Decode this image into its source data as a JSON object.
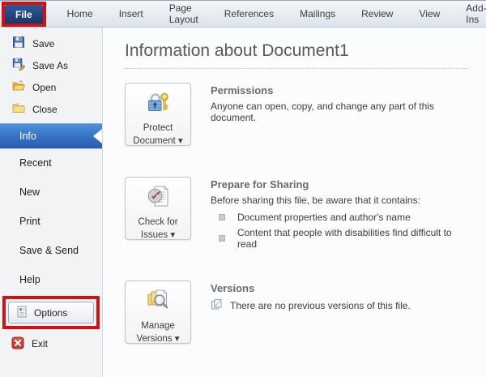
{
  "ribbon": {
    "tabs": [
      {
        "label": "File",
        "active": true
      },
      {
        "label": "Home"
      },
      {
        "label": "Insert"
      },
      {
        "label": "Page Layout"
      },
      {
        "label": "References"
      },
      {
        "label": "Mailings"
      },
      {
        "label": "Review"
      },
      {
        "label": "View"
      },
      {
        "label": "Add-Ins"
      }
    ]
  },
  "sidebar": {
    "file_commands": [
      {
        "label": "Save",
        "icon": "save-icon"
      },
      {
        "label": "Save As",
        "icon": "save-as-icon"
      },
      {
        "label": "Open",
        "icon": "open-folder-icon"
      },
      {
        "label": "Close",
        "icon": "close-folder-icon"
      }
    ],
    "nav_items": [
      {
        "label": "Info",
        "selected": true
      },
      {
        "label": "Recent"
      },
      {
        "label": "New"
      },
      {
        "label": "Print"
      },
      {
        "label": "Save & Send"
      },
      {
        "label": "Help"
      }
    ],
    "options_label": "Options",
    "exit_label": "Exit"
  },
  "content": {
    "title": "Information about Document1",
    "sections": [
      {
        "button_line1": "Protect",
        "button_line2": "Document ▾",
        "heading": "Permissions",
        "description": "Anyone can open, copy, and change any part of this document."
      },
      {
        "button_line1": "Check for",
        "button_line2": "Issues ▾",
        "heading": "Prepare for Sharing",
        "description": "Before sharing this file, be aware that it contains:",
        "bullets": [
          "Document properties and author's name",
          "Content that people with disabilities find difficult to read"
        ]
      },
      {
        "button_line1": "Manage",
        "button_line2": "Versions ▾",
        "heading": "Versions",
        "description": "There are no previous versions of this file."
      }
    ]
  },
  "annotations": {
    "highlight_color": "#d01212"
  }
}
